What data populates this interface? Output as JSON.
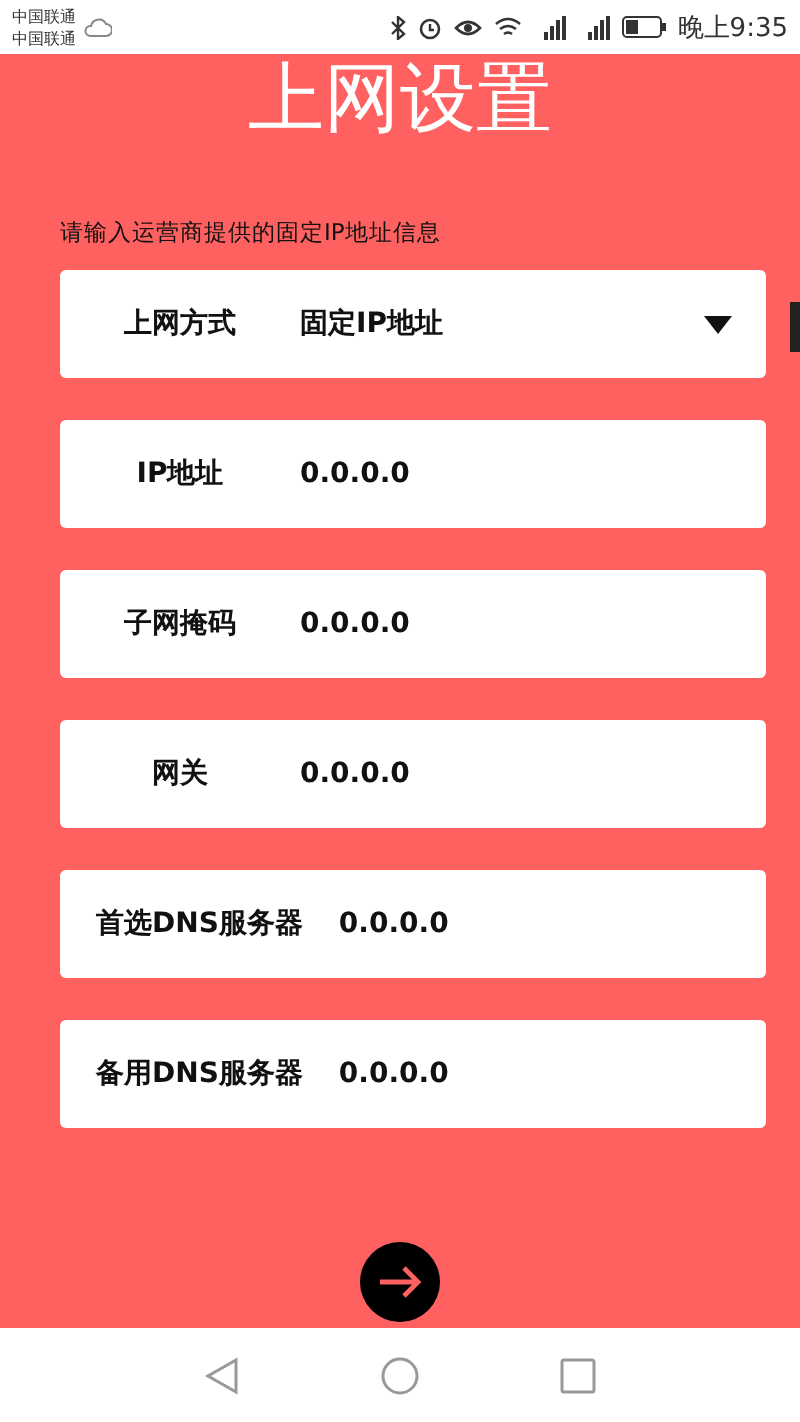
{
  "status_bar": {
    "carriers": [
      "中国联通",
      "中国联通"
    ],
    "time": "晚上9:35"
  },
  "title": "上网设置",
  "hint": "请输入运营商提供的固定IP地址信息",
  "fields": [
    {
      "label": "上网方式",
      "value": "固定IP地址",
      "kind": "select"
    },
    {
      "label": "IP地址",
      "value": "0.0.0.0",
      "kind": "text"
    },
    {
      "label": "子网掩码",
      "value": "0.0.0.0",
      "kind": "text"
    },
    {
      "label": "网关",
      "value": "0.0.0.0",
      "kind": "text"
    },
    {
      "label": "首选DNS服务器",
      "value": "0.0.0.0",
      "kind": "text"
    },
    {
      "label": "备用DNS服务器",
      "value": "0.0.0.0",
      "kind": "text"
    }
  ]
}
